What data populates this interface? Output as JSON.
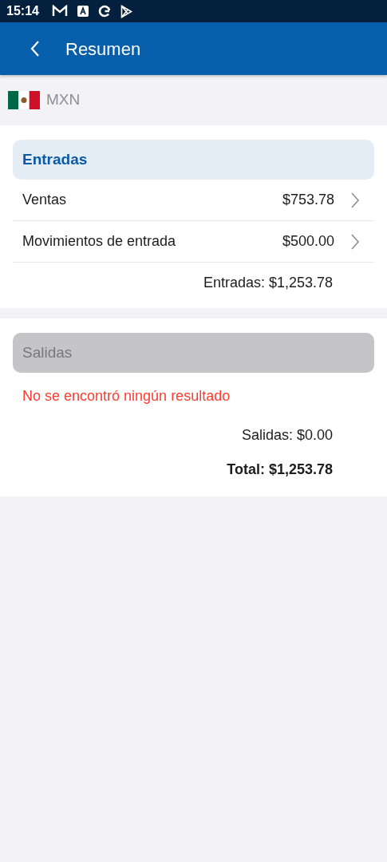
{
  "status_bar": {
    "time": "15:14"
  },
  "app_bar": {
    "title": "Resumen"
  },
  "currency": {
    "code": "MXN"
  },
  "sections": [
    {
      "title": "Entradas",
      "disabled": false,
      "rows": [
        {
          "label": "Ventas",
          "amount": "$753.78"
        },
        {
          "label": "Movimientos de entrada",
          "amount": "$500.00"
        }
      ],
      "subtotal": "Entradas: $1,253.78"
    },
    {
      "title": "Salidas",
      "disabled": true,
      "empty_message": "No se encontró ningún resultado",
      "subtotal": "Salidas: $0.00",
      "total": "Total: $1,253.78"
    }
  ]
}
